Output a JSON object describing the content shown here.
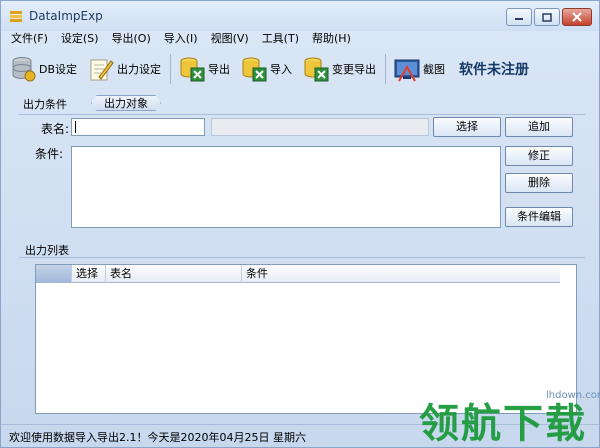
{
  "window": {
    "title": "DataImpExp"
  },
  "menu": [
    "文件(F)",
    "设定(S)",
    "导出(O)",
    "导入(I)",
    "视图(V)",
    "工具(T)",
    "帮助(H)"
  ],
  "toolbar": {
    "db_settings": "DB设定",
    "output_settings": "出力设定",
    "export": "导出",
    "import": "导入",
    "change_export": "变更导出",
    "screenshot": "截图",
    "unregistered": "软件未注册"
  },
  "condition_panel": {
    "title": "出力条件",
    "tab": "出力对象",
    "table_label": "表名:",
    "table_value": "",
    "condition_label": "条件:",
    "select_button": "选择",
    "add_button": "追加",
    "modify_button": "修正",
    "delete_button": "删除",
    "edit_condition_button": "条件编辑"
  },
  "output_list": {
    "title": "出力列表",
    "columns": [
      "选择",
      "表名",
      "条件"
    ]
  },
  "status": "欢迎使用数据导入导出2.1！今天是2020年04月25日   星期六",
  "watermark": {
    "logo": "领航下载",
    "url": "lhdown.com"
  },
  "colors": {
    "accent": "#1c9a3c",
    "window_bg": "#c9d9ee",
    "close_button": "#c4412b"
  }
}
